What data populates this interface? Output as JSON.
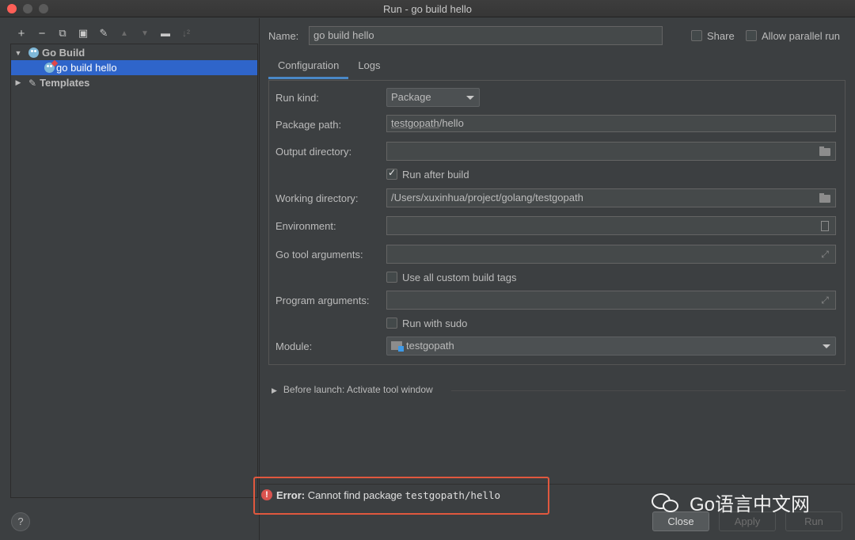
{
  "window": {
    "title": "Run - go build hello"
  },
  "toolbar": {
    "add": "+",
    "remove": "−",
    "copy": "⧉",
    "save": "▣",
    "edit": "🔧",
    "up": "▲",
    "down": "▼",
    "folder": "📁",
    "sort": "↓²"
  },
  "tree": {
    "group_label": "Go Build",
    "item_label": "go build hello",
    "templates_label": "Templates"
  },
  "form": {
    "name_label": "Name:",
    "name_value": "go build hello",
    "share_label": "Share",
    "parallel_label": "Allow parallel run",
    "tabs": [
      "Configuration",
      "Logs"
    ],
    "run_kind_label": "Run kind:",
    "run_kind_value": "Package",
    "package_path_label": "Package path:",
    "package_path_value_prefix": "testgopath",
    "package_path_value_suffix": "/hello",
    "output_dir_label": "Output directory:",
    "output_dir_value": "",
    "run_after_build_label": "Run after build",
    "working_dir_label": "Working directory:",
    "working_dir_value": "/Users/xuxinhua/project/golang/testgopath",
    "environment_label": "Environment:",
    "go_tool_args_label": "Go tool arguments:",
    "custom_tags_label": "Use all custom build tags",
    "program_args_label": "Program arguments:",
    "run_with_sudo_label": "Run with sudo",
    "module_label": "Module:",
    "module_value": "testgopath"
  },
  "before_launch": "Before launch: Activate tool window",
  "error": {
    "prefix": "Error:",
    "message": "Cannot find package",
    "package": "testgopath/hello"
  },
  "buttons": {
    "close": "Close",
    "apply": "Apply",
    "run": "Run",
    "help": "?"
  },
  "watermark": {
    "text": "Go语言中文网"
  },
  "colors": {
    "accent": "#2f65ca",
    "tab_underline": "#4a88c7",
    "error_border": "#e0583e",
    "background": "#3c3f41"
  }
}
